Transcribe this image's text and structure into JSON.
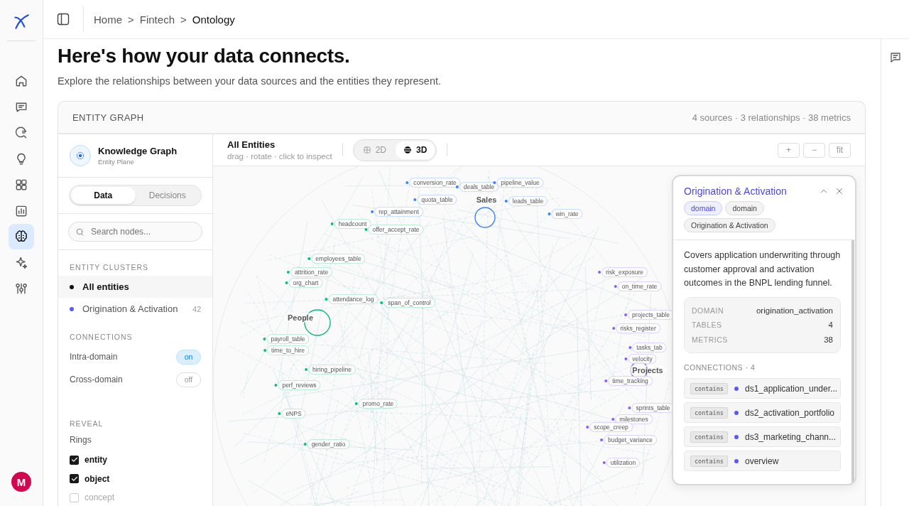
{
  "nav": {
    "items": [
      {
        "selected": false
      },
      {
        "selected": false
      },
      {
        "selected": false
      },
      {
        "selected": false
      },
      {
        "selected": false
      },
      {
        "selected": false
      },
      {
        "selected": true
      },
      {
        "selected": false
      },
      {
        "selected": false
      }
    ],
    "avatar": "M"
  },
  "breadcrumb": [
    {
      "kind": "link",
      "label": "Home"
    },
    {
      "kind": "separator",
      "label": ">"
    },
    {
      "kind": "link",
      "label": "Fintech"
    },
    {
      "kind": "separator",
      "label": ">"
    },
    {
      "kind": "current",
      "label": "Ontology"
    }
  ],
  "heading": "Here's how your data connects.",
  "subtitle": "Explore the relationships between your data sources and the entities they represent.",
  "card": {
    "title": "ENTITY GRAPH",
    "stats": "4 sources · 3 relationships · 38 metrics"
  },
  "left_panel": {
    "title": "Knowledge Graph",
    "subtitle": "Entity Plane",
    "tabs": [
      {
        "label": "Data",
        "selected": true
      },
      {
        "label": "Decisions",
        "selected": false
      }
    ],
    "search": {
      "placeholder": "Search nodes..."
    },
    "clusters_label": "ENTITY CLUSTERS",
    "clusters": [
      {
        "label": "All entities",
        "selected": true,
        "color": "#111111"
      },
      {
        "label": "Origination & Activation",
        "selected": false,
        "color": "#5b5bf0",
        "count": "42"
      }
    ],
    "connections_label": "CONNECTIONS",
    "toggles": [
      {
        "label": "Intra-domain",
        "on": true,
        "value": "on"
      },
      {
        "label": "Cross-domain",
        "on": false,
        "value": "off"
      }
    ],
    "reveal_label": "REVEAL",
    "rings_label": "Rings",
    "rings": [
      {
        "label": "entity",
        "checked": true
      },
      {
        "label": "object",
        "checked": true
      },
      {
        "label": "concept",
        "checked": false
      }
    ]
  },
  "graph": {
    "title": "All Entities",
    "hint": "drag · rotate · click to inspect",
    "views": [
      {
        "label": "2D",
        "selected": false
      },
      {
        "label": "3D",
        "selected": true
      }
    ],
    "zoom_buttons": [
      "+",
      "−",
      "fit"
    ],
    "nodes": [
      {
        "label": "conversion_rate",
        "kind": "metric",
        "color": "#3b82f6"
      },
      {
        "label": "deals_table",
        "kind": "metric",
        "color": "#3b82f6"
      },
      {
        "label": "pipeline_value",
        "kind": "metric",
        "color": "#3b82f6"
      },
      {
        "label": "quota_table",
        "kind": "metric",
        "color": "#3b82f6"
      },
      {
        "label": "Sales",
        "kind": "cluster",
        "color": "#3b82f6"
      },
      {
        "label": "leads_table",
        "kind": "metric",
        "color": "#3b82f6"
      },
      {
        "label": "rep_attainment",
        "kind": "metric",
        "color": "#3b82f6"
      },
      {
        "label": "win_rate",
        "kind": "metric",
        "color": "#3b82f6"
      },
      {
        "label": "headcount",
        "kind": "metric",
        "color": "#10b981"
      },
      {
        "label": "offer_accept_rate",
        "kind": "metric",
        "color": "#10b981"
      },
      {
        "label": "employees_table",
        "kind": "metric",
        "color": "#10b981"
      },
      {
        "label": "attrition_rate",
        "kind": "metric",
        "color": "#10b981"
      },
      {
        "label": "org_chart",
        "kind": "metric",
        "color": "#10b981"
      },
      {
        "label": "attendance_log",
        "kind": "metric",
        "color": "#10b981"
      },
      {
        "label": "span_of_control",
        "kind": "metric",
        "color": "#10b981"
      },
      {
        "label": "People",
        "kind": "cluster",
        "color": "#10b981"
      },
      {
        "label": "payroll_table",
        "kind": "metric",
        "color": "#10b981"
      },
      {
        "label": "time_to_hire",
        "kind": "metric",
        "color": "#10b981"
      },
      {
        "label": "hiring_pipeline",
        "kind": "metric",
        "color": "#10b981"
      },
      {
        "label": "perf_reviews",
        "kind": "metric",
        "color": "#10b981"
      },
      {
        "label": "eNPS",
        "kind": "metric",
        "color": "#10b981"
      },
      {
        "label": "promo_rate",
        "kind": "metric",
        "color": "#10b981"
      },
      {
        "label": "gender_ratio",
        "kind": "metric",
        "color": "#10b981"
      },
      {
        "label": "risk_exposure",
        "kind": "metric",
        "color": "#8b5cf6"
      },
      {
        "label": "on_time_rate",
        "kind": "metric",
        "color": "#8b5cf6"
      },
      {
        "label": "projects_table",
        "kind": "metric",
        "color": "#8b5cf6"
      },
      {
        "label": "risks_register",
        "kind": "metric",
        "color": "#8b5cf6"
      },
      {
        "label": "tasks_tab",
        "kind": "metric",
        "color": "#8b5cf6"
      },
      {
        "label": "velocity",
        "kind": "metric",
        "color": "#8b5cf6"
      },
      {
        "label": "Projects",
        "kind": "cluster",
        "color": "#8b5cf6"
      },
      {
        "label": "time_tracking",
        "kind": "metric",
        "color": "#8b5cf6"
      },
      {
        "label": "sprints_table",
        "kind": "metric",
        "color": "#8b5cf6"
      },
      {
        "label": "milestones",
        "kind": "metric",
        "color": "#8b5cf6"
      },
      {
        "label": "scope_creep",
        "kind": "metric",
        "color": "#8b5cf6"
      },
      {
        "label": "budget_variance",
        "kind": "metric",
        "color": "#8b5cf6"
      },
      {
        "label": "utilization",
        "kind": "metric",
        "color": "#8b5cf6"
      }
    ]
  },
  "inspector": {
    "title": "Origination & Activation",
    "tags": [
      {
        "label": "domain",
        "kind": "primary"
      },
      {
        "label": "domain",
        "kind": "plain"
      },
      {
        "label": "Origination & Activation",
        "kind": "plain"
      }
    ],
    "description": "Covers application underwriting through customer approval and activation outcomes in the BNPL lending funnel.",
    "details": [
      {
        "label": "DOMAIN",
        "value": "origination_activation"
      },
      {
        "label": "TABLES",
        "value": "4"
      },
      {
        "label": "METRICS",
        "value": "38"
      }
    ],
    "connections_label": "CONNECTIONS · 4",
    "connections": [
      {
        "relation": "contains",
        "color": "#5b5bf0",
        "name": "ds1_application_under..."
      },
      {
        "relation": "contains",
        "color": "#5b5bf0",
        "name": "ds2_activation_portfolio"
      },
      {
        "relation": "contains",
        "color": "#5b5bf0",
        "name": "ds3_marketing_chann..."
      },
      {
        "relation": "contains",
        "color": "#5b5bf0",
        "name": "overview"
      }
    ]
  }
}
